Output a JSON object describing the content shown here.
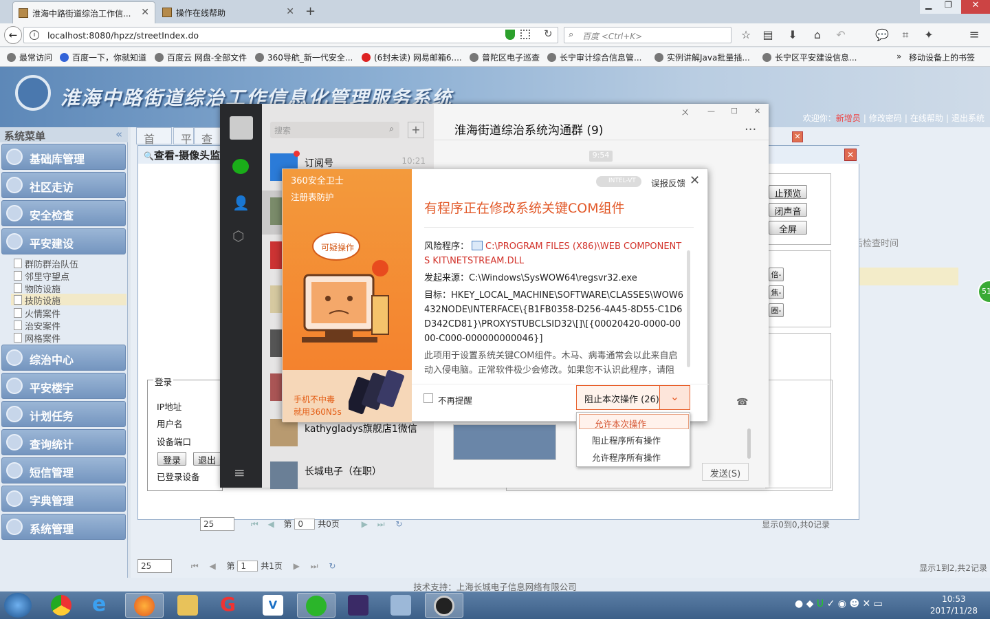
{
  "browser": {
    "tabs": [
      {
        "label": "淮海中路街道综治工作信..."
      },
      {
        "label": "操作在线帮助"
      }
    ],
    "url": "localhost:8080/hpzz/streetIndex.do",
    "search_placeholder": "百度 <Ctrl+K>",
    "bookmarks": [
      "最常访问",
      "百度一下，你就知道",
      "百度云 网盘-全部文件",
      "360导航_新一代安全...",
      "(6封未读) 网易邮箱6....",
      "普陀区电子巡查",
      "长宁审计综合信息管...",
      "实例讲解Java批量插...",
      "长宁区平安建设信息..."
    ],
    "bookmarks_more": "»",
    "mobile_bookmarks": "移动设备上的书签"
  },
  "app": {
    "title": "淮海中路街道综治工作信息化管理服务系统",
    "user_links": [
      "欢迎你：",
      "新增员",
      "修改密码",
      "在线帮助",
      "退出系统"
    ],
    "sidebar_title": "系统菜单",
    "sidebar_collapse": "«",
    "menus": [
      "基础库管理",
      "社区走访",
      "安全检查",
      "平安建设",
      "综治中心",
      "平安楼宇",
      "计划任务",
      "查询统计",
      "短信管理",
      "字典管理",
      "系统管理"
    ],
    "submenus": [
      "群防群治队伍",
      "邻里守望点",
      "物防设施",
      "技防设施",
      "火情案件",
      "治安案件",
      "网格案件"
    ],
    "content_tabs": [
      "首页",
      "平",
      "查"
    ],
    "footer": "技术支持：上海长城电子信息网络有限公司",
    "pager_bottom": {
      "page_size": "25",
      "page_label": "第",
      "page_value": "1",
      "total": "共1页",
      "summary": "显示1到2,共2记录"
    },
    "pager_inner": {
      "page_size": "25",
      "page_label": "第",
      "page_value": "0",
      "total": "共0页",
      "summary": "显示0到0,共0记录"
    },
    "col_header": "后检查时间",
    "green_badge": "51"
  },
  "dialog": {
    "title": "查看-摄像头监",
    "login_legend": "登录",
    "labels": [
      "IP地址",
      "用户名",
      "设备端口"
    ],
    "login_btn": "登录",
    "logout_btn": "退出",
    "logged_devices": "已登录设备",
    "right_buttons": [
      "止预览",
      "闭声音",
      "全屏"
    ],
    "right_buttons2": [
      "倍-",
      "焦-",
      "圈-"
    ]
  },
  "wechat": {
    "search_placeholder": "搜索",
    "add_btn": "+",
    "chat_title": "淮海街道综治系统沟通群 (9)",
    "more": "...",
    "time_badge": "9:54",
    "list": [
      {
        "name": "订阅号",
        "time": "10:21"
      },
      {
        "name": "kathygladys旗舰店1微信"
      },
      {
        "name": "长城电子（在职）"
      }
    ],
    "send_btn": "发送(S)",
    "win_controls": [
      "ㄨ",
      "—",
      "☐",
      "✕"
    ]
  },
  "popup360": {
    "brand": "360安全卫士",
    "subtitle": "注册表防护",
    "badge_text": "可疑操作",
    "vt_label": "INTEL-VT",
    "feedback": "误报反馈",
    "close": "✕",
    "headline": "有程序正在修改系统关键COM组件",
    "risk_label": "风险程序：",
    "risk_value": "C:\\PROGRAM FILES (X86)\\WEB COMPONENTS KIT\\NETSTREAM.DLL",
    "source_label": "发起来源：",
    "source_value": "C:\\Windows\\SysWOW64\\regsvr32.exe",
    "target_label": "目标：",
    "target_value": "HKEY_LOCAL_MACHINE\\SOFTWARE\\CLASSES\\WOW6432NODE\\INTERFACE\\{B1FB0358-D256-4A45-8D55-C1D6D342CD81}\\PROXYSTUBCLSID32\\[]\\[{00020420-0000-0000-C000-000000000046}]",
    "description": "此项用于设置系统关键COM组件。木马、病毒通常会以此来自启动入侵电脑。正常软件极少会修改。如果您不认识此程序，请阻",
    "no_remind": "不再提醒",
    "block_btn": "阻止本次操作 (26)",
    "ad_line1": "手机不中毒",
    "ad_line2": "就用360N5s",
    "menu": [
      "允许本次操作",
      "阻止程序所有操作",
      "允许程序所有操作"
    ]
  },
  "taskbar": {
    "time": "10:53",
    "date": "2017/11/28"
  }
}
